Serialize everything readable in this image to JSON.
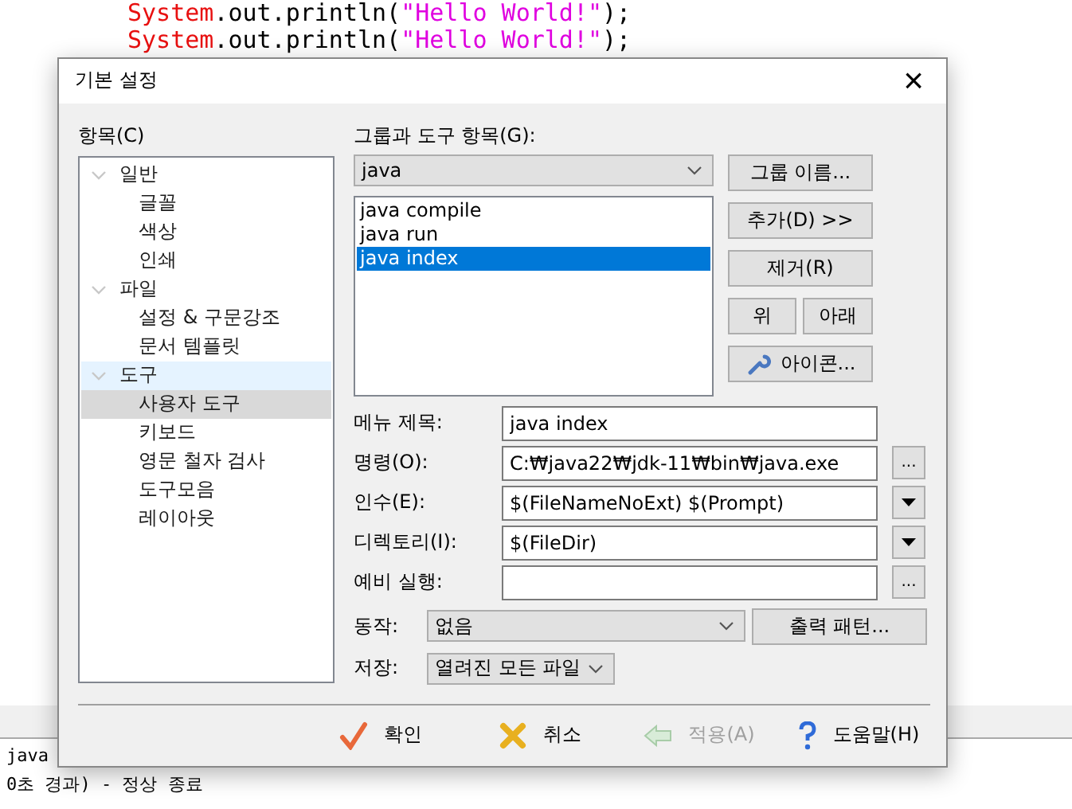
{
  "editor": {
    "code_lines": [
      [
        {
          "kind": "class",
          "text": "System"
        },
        {
          "kind": "plain",
          "text": ".out.println("
        },
        {
          "kind": "string",
          "text": "\"Hello World!\""
        },
        {
          "kind": "plain",
          "text": ");"
        }
      ],
      [
        {
          "kind": "class",
          "text": "System"
        },
        {
          "kind": "plain",
          "text": ".out.println("
        },
        {
          "kind": "string",
          "text": "\"Hello World!\""
        },
        {
          "kind": "plain",
          "text": ");"
        }
      ]
    ]
  },
  "output": {
    "lines": [
      "java",
      "0초 경과) - 정상 종료"
    ]
  },
  "dialog": {
    "title": "기본 설정",
    "close": "×",
    "tree": {
      "label": "항목(C)",
      "items": [
        {
          "label": "일반",
          "expanded": true,
          "selected": false,
          "hovered": false,
          "children": [
            {
              "label": "글꼴",
              "selected": false
            },
            {
              "label": "색상",
              "selected": false
            },
            {
              "label": "인쇄",
              "selected": false
            }
          ]
        },
        {
          "label": "파일",
          "expanded": true,
          "selected": false,
          "hovered": false,
          "children": [
            {
              "label": "설정 & 구문강조",
              "selected": false
            },
            {
              "label": "문서 템플릿",
              "selected": false
            }
          ]
        },
        {
          "label": "도구",
          "expanded": true,
          "selected": false,
          "hovered": true,
          "children": [
            {
              "label": "사용자 도구",
              "selected": true
            },
            {
              "label": "키보드",
              "selected": false
            },
            {
              "label": "영문 철자 검사",
              "selected": false
            },
            {
              "label": "도구모음",
              "selected": false
            },
            {
              "label": "레이아웃",
              "selected": false
            }
          ]
        }
      ]
    },
    "group_label": "그룹과 도구 항목(G):",
    "group_select": {
      "value": "java"
    },
    "tools": [
      {
        "label": "java compile",
        "selected": false
      },
      {
        "label": "java run",
        "selected": false
      },
      {
        "label": "java index",
        "selected": true
      }
    ],
    "side_buttons": {
      "rename": "그룹 이름...",
      "add": "추가(D) >>",
      "remove": "제거(R)",
      "up": "위",
      "down": "아래",
      "icon": "아이콘..."
    },
    "fields": [
      {
        "label": "메뉴 제목:",
        "value": "java index",
        "kind": "text"
      },
      {
        "label": "명령(O):",
        "value": "C:₩java22₩jdk-11₩bin₩java.exe",
        "kind": "browse",
        "button": "..."
      },
      {
        "label": "인수(E):",
        "value": "$(FileNameNoExt) $(Prompt)",
        "kind": "menu"
      },
      {
        "label": "디렉토리(I):",
        "value": "$(FileDir)",
        "kind": "menu"
      },
      {
        "label": "예비 실행:",
        "kind": "browse",
        "button": "..."
      }
    ],
    "action": {
      "label": "동작:",
      "value": "없음",
      "button": "출력 패턴..."
    },
    "save": {
      "label": "저장:",
      "value": "열려진 모든 파일"
    },
    "footer": [
      {
        "kind": "ok",
        "label": "확인",
        "disabled": false
      },
      {
        "kind": "cancel",
        "label": "취소",
        "disabled": false
      },
      {
        "kind": "apply",
        "label": "적용(A)",
        "disabled": true
      },
      {
        "kind": "help",
        "label": "도움말(H)",
        "disabled": false
      }
    ]
  }
}
